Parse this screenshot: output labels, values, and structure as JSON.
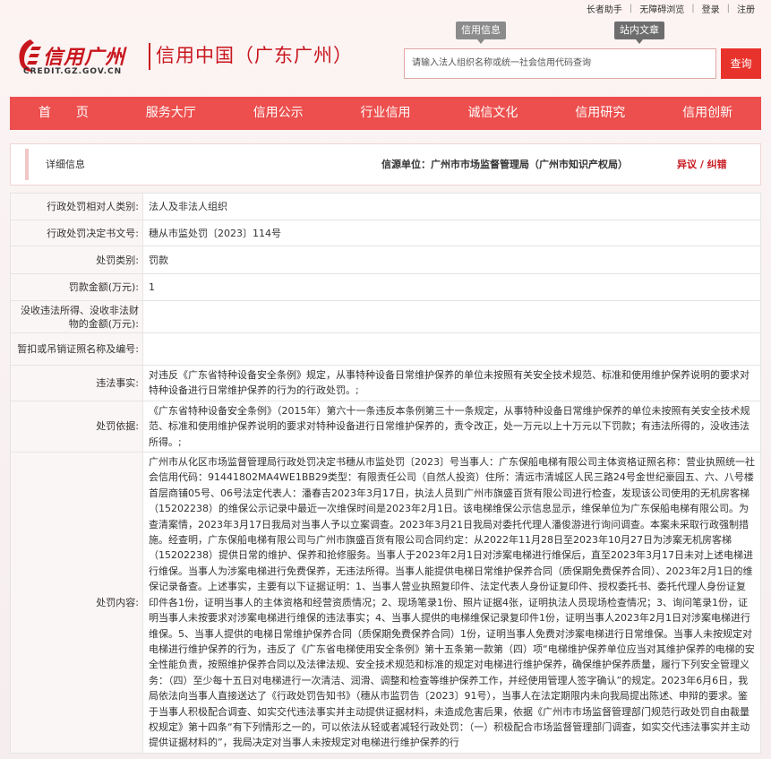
{
  "top_links": [
    "长者助手",
    "无障碍浏览",
    "登录",
    "注册"
  ],
  "logo": {
    "cn": "信用广州",
    "en": "CREDIT.GZ.GOV.CN",
    "site": "信用中国（广东广州）"
  },
  "header_tags": {
    "credit_info": "信用信息",
    "site_search": "站内文章"
  },
  "search": {
    "placeholder": "请输入法人组织名称或统一社会信用代码查询",
    "button": "查询"
  },
  "nav": [
    "首　　页",
    "服务大厅",
    "信用公示",
    "行业信用",
    "诚信文化",
    "信用研究",
    "信用创新"
  ],
  "detail": {
    "title": "详细信息",
    "source": "信源单位：广州市市场监督管理局（广州市知识产权局）",
    "objection": "异议 / 纠错"
  },
  "rows": [
    {
      "label": "行政处罚相对人类别:",
      "value": "法人及非法人组织"
    },
    {
      "label": "行政处罚决定书文号:",
      "value": "穗从市监处罚〔2023〕114号"
    },
    {
      "label": "处罚类别:",
      "value": "罚款"
    },
    {
      "label": "罚款金额(万元):",
      "value": "1"
    },
    {
      "label": "没收违法所得、没收非法财物的金额(万元):",
      "value": ""
    },
    {
      "label": "暂扣或吊销证照名称及编号:",
      "value": ""
    },
    {
      "label": "违法事实:",
      "value": "对违反《广东省特种设备安全条例》规定，从事特种设备日常维护保养的单位未按照有关安全技术规范、标准和使用维护保养说明的要求对特种设备进行日常维护保养的行为的行政处罚。;"
    },
    {
      "label": "处罚依据:",
      "value": "《广东省特种设备安全条例》（2015年）第六十一条违反本条例第三十一条规定，从事特种设备日常维护保养的单位未按照有关安全技术规范、标准和使用维护保养说明的要求对特种设备进行日常维护保养的，责令改正，处一万元以上十万元以下罚款；有违法所得的，没收违法所得。;"
    },
    {
      "label": "处罚内容:",
      "value": "广州市从化区市场监督管理局行政处罚决定书穗从市监处罚〔2023〕号当事人：广东保船电梯有限公司主体资格证照名称：营业执照统一社会信用代码：91441802MA4WE1BB29类型：有限责任公司（自然人投资）住所：清远市清城区人民三路24号金世纪豪园五、六、八号楼首层商铺05号、06号法定代表人：潘春吉2023年3月17日，执法人员到广州市旗盛百货有限公司进行检查，发现该公司使用的无机房客梯（15202238）的维保公示记录中最近一次维保时间是2023年2月1日。该电梯维保公示信息显示，维保单位为广东保船电梯有限公司。为查清案情，2023年3月17日我局对当事人予以立案调查。2023年3月21日我局对委托代理人潘俊游进行询问调查。本案未采取行政强制措施。经查明，广东保船电梯有限公司与广州市旗盛百货有限公司合同约定：从2022年11月28日至2023年10月27日为涉案无机房客梯（15202238）提供日常的维护、保养和抢修服务。当事人于2023年2月1日对涉案电梯进行维保后，直至2023年3月17日未对上述电梯进行维保。当事人为涉案电梯进行免费保养，无违法所得。当事人能提供电梯日常维护保养合同（质保期免费保养合同）、2023年2月1日的维保记录备查。上述事实，主要有以下证据证明：1、当事人营业执照复印件、法定代表人身份证复印件、授权委托书、委托代理人身份证复印件各1份，证明当事人的主体资格和经营资质情况；2、现场笔录1份、照片证据4张，证明执法人员现场检查情况；3、询问笔录1份，证明当事人未按要求对涉案电梯进行维保的违法事实；4、当事人提供的电梯维保记录复印件1份，证明当事人2023年2月1日对涉案电梯进行维保。5、当事人提供的电梯日常维护保养合同（质保期免费保养合同）1份，证明当事人免费对涉案电梯进行日常维保。当事人未按规定对电梯进行维护保养的行为，违反了《广东省电梯使用安全条例》第十五条第一款第（四）项“电梯维护保养单位应当对其维护保养的电梯的安全性能负责，按照维护保养合同以及法律法规、安全技术规范和标准的规定对电梯进行维护保养，确保维护保养质量，履行下列安全管理义务：（四）至少每十五日对电梯进行一次清洁、润滑、调整和检查等维护保养工作，并经使用管理人签字确认”的规定。2023年6月6日，我局依法向当事人直接送达了《行政处罚告知书》（穗从市监罚告〔2023〕91号），当事人在法定期限内未向我局提出陈述、申辩的要求。鉴于当事人积极配合调查、如实交代违法事实并主动提供证据材料，未造成危害后果，依据《广州市市场监督管理部门规范行政处罚自由裁量权规定》第十四条“有下列情形之一的，可以依法从轻或者减轻行政处罚：（一）积极配合市场监督管理部门调查，如实交代违法事实并主动提供证据材料的”，我局决定对当事人未按规定对电梯进行维护保养的行"
    }
  ],
  "colors": {
    "brand_red": "#c8161d",
    "nav_red": "#ec4f4d",
    "search_red": "#e8332c"
  }
}
